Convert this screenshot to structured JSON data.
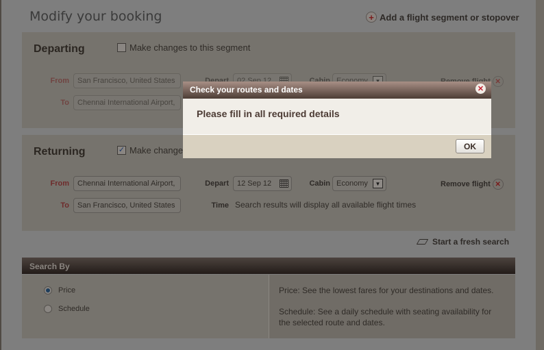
{
  "page": {
    "title": "Modify your booking",
    "add_segment_label": "Add a flight segment or stopover",
    "add_segment_icon": "plus-circle-icon"
  },
  "departing": {
    "title": "Departing",
    "make_changes_label": "Make changes to this segment",
    "make_changes_checked": false,
    "from_label": "From",
    "from_value": "San Francisco, United States",
    "to_label": "To",
    "to_value": "Chennai International Airport,",
    "depart_label": "Depart",
    "depart_value": "02 Sep 12",
    "cabin_label": "Cabin",
    "cabin_value": "Economy",
    "remove_label": "Remove flight"
  },
  "returning": {
    "title": "Returning",
    "make_changes_label": "Make changes to this segment",
    "make_changes_checked": true,
    "from_label": "From",
    "from_value": "Chennai International Airport,",
    "to_label": "To",
    "to_value": "San Francisco, United States",
    "depart_label": "Depart",
    "depart_value": "12 Sep 12",
    "cabin_label": "Cabin",
    "cabin_value": "Economy",
    "remove_label": "Remove flight",
    "time_label": "Time",
    "time_text": "Search results will display all available flight times"
  },
  "fresh_search_label": "Start a fresh search",
  "search_by": {
    "header": "Search By",
    "options": [
      {
        "label": "Price",
        "selected": true
      },
      {
        "label": "Schedule",
        "selected": false
      }
    ],
    "price_desc": "Price: See the lowest fares for your destinations and dates.",
    "schedule_desc": "Schedule: See a daily schedule with seating availability for the selected route and dates."
  },
  "dialog": {
    "title": "Check your routes and dates",
    "message": "Please fill in all required details",
    "ok_label": "OK"
  }
}
